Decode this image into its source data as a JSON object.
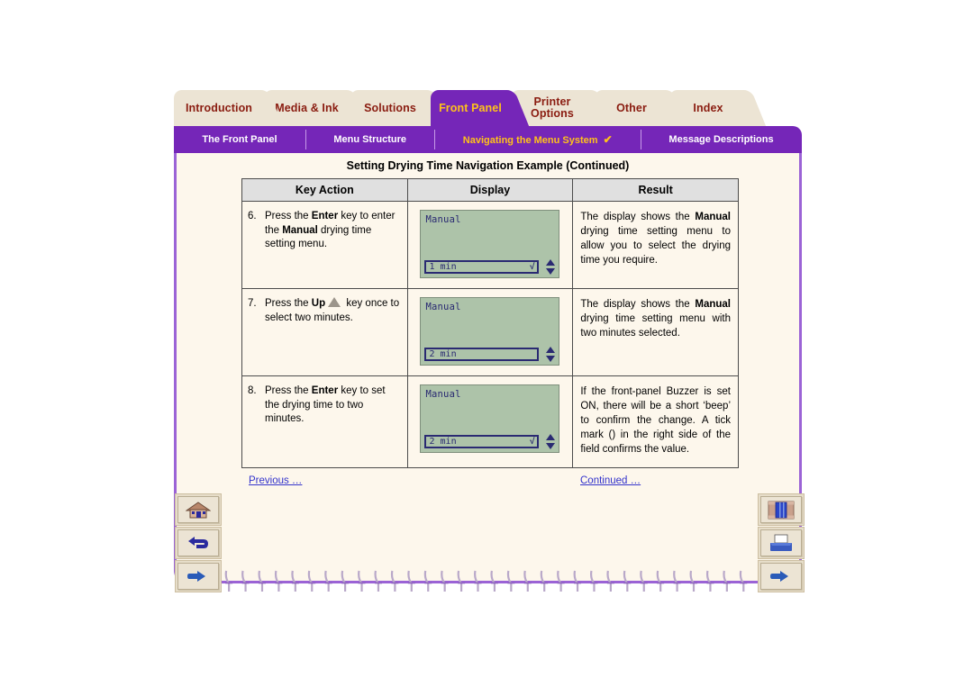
{
  "tabs": [
    {
      "label": "Introduction",
      "active": false
    },
    {
      "label": "Media & Ink",
      "active": false
    },
    {
      "label": "Solutions",
      "active": false
    },
    {
      "label": "Front Panel",
      "active": true
    },
    {
      "label": "Printer Options",
      "active": false
    },
    {
      "label": "Other",
      "active": false
    },
    {
      "label": "Index",
      "active": false
    }
  ],
  "subnav": [
    {
      "label": "The Front Panel",
      "active": false,
      "tick": ""
    },
    {
      "label": "Menu Structure",
      "active": false,
      "tick": ""
    },
    {
      "label": "Navigating the Menu System",
      "active": true,
      "tick": "✔"
    },
    {
      "label": "Message Descriptions",
      "active": false,
      "tick": ""
    }
  ],
  "document": {
    "title": "Setting Drying Time Navigation Example (Continued)"
  },
  "table": {
    "headers": [
      "Key Action",
      "Display",
      "Result"
    ],
    "rows": [
      {
        "num": "6.",
        "action_pre": "Press the ",
        "action_b1": "Enter",
        "action_mid": " key to enter the ",
        "action_b2": "Manual",
        "action_post": " drying time setting menu.",
        "lcd_title": "Manual",
        "lcd_value": "1 min",
        "lcd_check": "√",
        "result_pre": "The display shows the ",
        "result_b": "Manual",
        "result_post": " drying time setting menu to allow you to select the drying time you require."
      },
      {
        "num": "7.",
        "action_pre": "Press the ",
        "action_b1": "Up",
        "action_mid": " ",
        "action_b2": "",
        "action_post": " key once to select two minutes.",
        "lcd_title": "Manual",
        "lcd_value": "2 min",
        "lcd_check": "",
        "result_pre": "The display shows the ",
        "result_b": "Manual",
        "result_post": " drying time setting menu with two minutes selected."
      },
      {
        "num": "8.",
        "action_pre": "Press the ",
        "action_b1": "Enter",
        "action_mid": " key to set the drying time to two minutes.",
        "action_b2": "",
        "action_post": "",
        "lcd_title": "Manual",
        "lcd_value": "2 min",
        "lcd_check": "√",
        "result_pre": "If the front-panel Buzzer is set ON, there will be a short ‘beep’ to confirm the change. A tick mark () in the right side of the field confirms the value.",
        "result_b": "",
        "result_post": ""
      }
    ]
  },
  "links": {
    "previous": "Previous …",
    "continued": "Continued …"
  },
  "nav_icons": {
    "left": [
      "home-icon",
      "back-arrow-icon",
      "pointing-hand-icon"
    ],
    "right": [
      "bookshelf-index-icon",
      "printer-icon",
      "pointing-hand-icon"
    ]
  },
  "colors": {
    "purple": "#7526b8",
    "gold": "#ffc21a",
    "tab_cream": "#ece4d4",
    "tab_text": "#8a1c10",
    "page_bg": "#fdf7ec",
    "lcd_green": "#adc3a9",
    "lcd_navy": "#2a2a72",
    "link_blue": "#3333cc"
  }
}
